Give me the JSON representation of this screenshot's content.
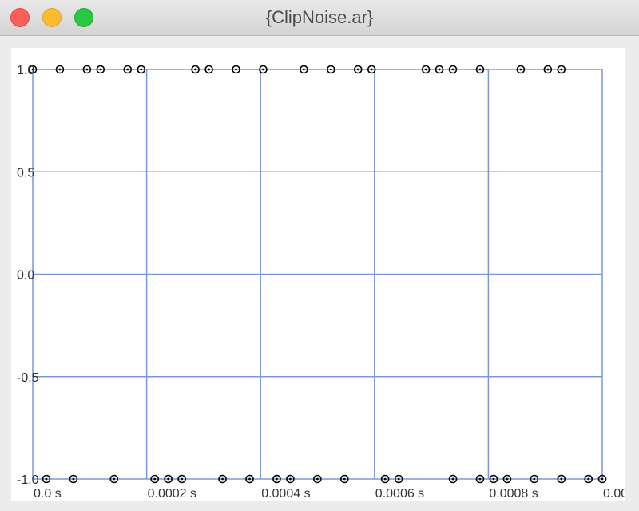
{
  "window": {
    "title": "{ClipNoise.ar}"
  },
  "colors": {
    "grid": "#7b98d6",
    "marker": "#000000",
    "tick_text": "#333333"
  },
  "chart_data": {
    "type": "scatter",
    "title": "",
    "xlabel": "",
    "ylabel": "",
    "xlim": [
      0.0,
      0.001
    ],
    "ylim": [
      -1.0,
      1.0
    ],
    "grid": true,
    "marker": "open-circle",
    "xtick_values": [
      0.0,
      0.0002,
      0.0004,
      0.0006,
      0.0008,
      0.001
    ],
    "xtick_labels": [
      "0.0 s",
      "0.0002 s",
      "0.0004 s",
      "0.0006 s",
      "0.0008 s",
      "0.00"
    ],
    "ytick_values": [
      1.0,
      0.5,
      0.0,
      -0.5,
      -1.0
    ],
    "ytick_labels": [
      "1.0",
      "0.5",
      "0.0",
      "-0.5",
      "-1.0"
    ],
    "series": [
      {
        "x": [
          0.0,
          4.76e-05,
          9.52e-05,
          0.000119,
          0.0001666,
          0.0001904,
          0.0002856,
          0.0003094,
          0.000357,
          0.0004046,
          0.000476,
          0.0005236,
          0.0005712,
          0.000595,
          0.0006902,
          0.000714,
          0.0007378,
          0.0007854,
          0.0008806,
          0.0009044,
          0.0009282,
          0.000952
        ],
        "y": [
          -1.0,
          1.0,
          -1.0,
          1.0,
          1.0,
          -1.0,
          -1.0,
          1.0,
          -1.0,
          -1.0,
          1.0,
          -1.0,
          1.0,
          -1.0,
          -1.0,
          1.0,
          1.0,
          -1.0,
          -1.0,
          1.0,
          -1.0,
          -1.0
        ]
      }
    ],
    "points_top_x": [
      0.0,
      4.76e-05,
      9.52e-05,
      0.000119,
      0.0001666,
      0.0001904,
      0.0002856,
      0.0003094,
      0.000357,
      0.0004046,
      0.000476,
      0.0005236,
      0.0005712,
      0.000595,
      0.0006902,
      0.000714,
      0.0007378,
      0.0007854,
      0.0008568,
      0.0009044,
      0.0009282
    ],
    "points_bottom_x": [
      2.38e-05,
      7.14e-05,
      0.0001428,
      0.0002142,
      0.000238,
      0.0002618,
      0.0003332,
      0.0003808,
      0.0004284,
      0.0004522,
      0.0004998,
      0.0005474,
      0.0006188,
      0.0006426,
      0.0007378,
      0.0007854,
      0.0008092,
      0.000833,
      0.0008806,
      0.0009282,
      0.0009758,
      0.001
    ]
  }
}
